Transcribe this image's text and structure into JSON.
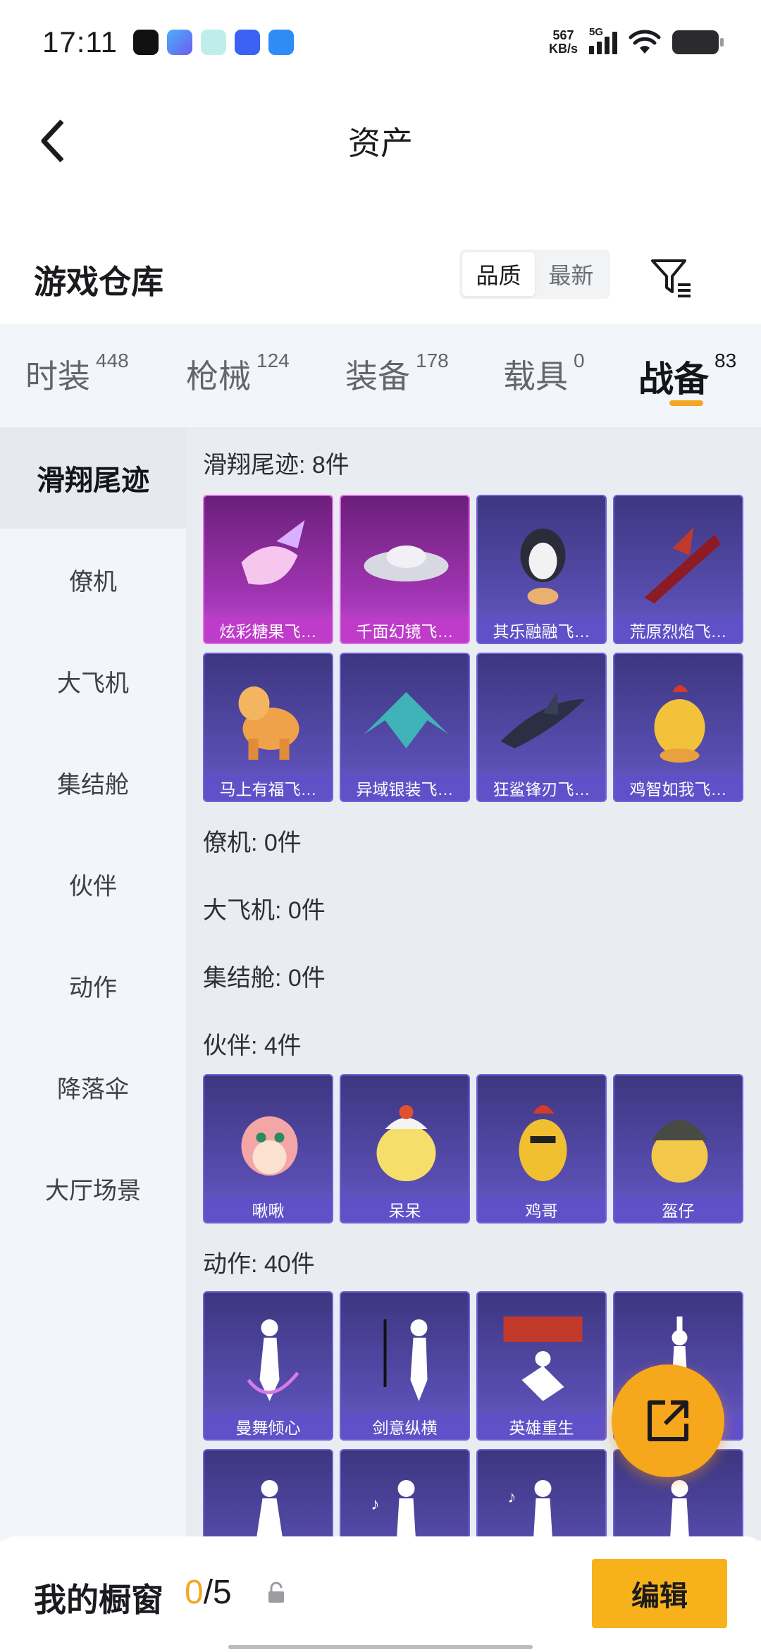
{
  "status_bar": {
    "time": "17:11",
    "net_speed_value": "567",
    "net_speed_unit": "KB/s",
    "network": "5G",
    "app_icons": [
      {
        "name": "tiktok-icon",
        "color": "#111111"
      },
      {
        "name": "app-blue-icon",
        "color": "#4b8cf5"
      },
      {
        "name": "app-cyan-icon",
        "color": "#8de0e0"
      },
      {
        "name": "vivo-icon",
        "color": "#3b62f2"
      },
      {
        "name": "app-sky-icon",
        "color": "#2d8cf5"
      }
    ]
  },
  "nav": {
    "title": "资产"
  },
  "header": {
    "title": "游戏仓库",
    "sort_options": [
      "品质",
      "最新"
    ],
    "sort_selected": "品质"
  },
  "tabs": [
    {
      "label": "时装",
      "count": "448"
    },
    {
      "label": "枪械",
      "count": "124"
    },
    {
      "label": "装备",
      "count": "178"
    },
    {
      "label": "载具",
      "count": "0"
    },
    {
      "label": "战备",
      "count": "83",
      "active": true
    }
  ],
  "sidebar": {
    "items": [
      "滑翔尾迹",
      "僚机",
      "大飞机",
      "集结舱",
      "伙伴",
      "动作",
      "降落伞",
      "大厅场景"
    ],
    "active": "滑翔尾迹"
  },
  "sections": {
    "glide": {
      "label": "滑翔尾迹: 8件",
      "items": [
        "炫彩糖果飞…",
        "千面幻镜飞…",
        "其乐融融飞…",
        "荒原烈焰飞…",
        "马上有福飞…",
        "异域银装飞…",
        "狂鲨锋刃飞…",
        "鸡智如我飞…"
      ]
    },
    "wingman": {
      "label": "僚机: 0件"
    },
    "plane": {
      "label": "大飞机: 0件"
    },
    "pod": {
      "label": "集结舱: 0件"
    },
    "companion": {
      "label": "伙伴: 4件",
      "items": [
        "啾啾",
        "呆呆",
        "鸡哥",
        "盔仔"
      ]
    },
    "emote": {
      "label": "动作: 40件",
      "items": [
        "曼舞倾心",
        "剑意纵横",
        "英雄重生",
        "",
        "",
        "",
        "",
        ""
      ]
    }
  },
  "bottom": {
    "showcase_label": "我的橱窗",
    "showcase_current": "0",
    "showcase_total": "/5",
    "edit_label": "编辑"
  },
  "colors": {
    "accent": "#f5a623",
    "card_purple": "#5a4fb3",
    "card_pink": "#a336b5"
  }
}
